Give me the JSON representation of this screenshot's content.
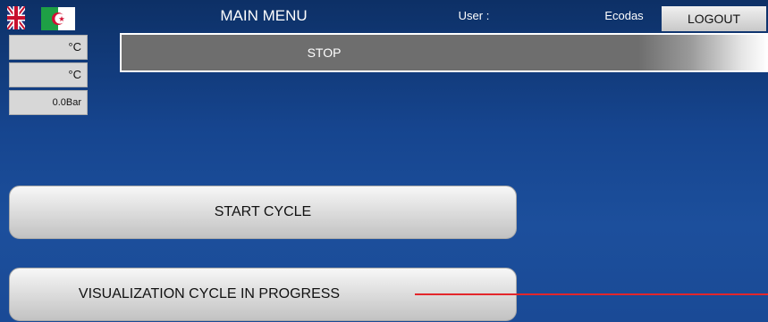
{
  "header": {
    "title": "MAIN MENU",
    "user_label": "User :",
    "user_name": "Ecodas",
    "logout_label": "LOGOUT"
  },
  "flags": [
    "uk-flag-icon",
    "algeria-flag-icon"
  ],
  "readouts": [
    {
      "value": "°C"
    },
    {
      "value": "°C"
    },
    {
      "value": "0.0Bar"
    }
  ],
  "status": {
    "text": "STOP"
  },
  "buttons": {
    "start_cycle": "START CYCLE",
    "visualization": "VISUALIZATION CYCLE IN PROGRESS"
  },
  "colors": {
    "background": "#1a4a96",
    "status_bar": "#6e6e6e",
    "indicator_line": "#e3262b"
  }
}
